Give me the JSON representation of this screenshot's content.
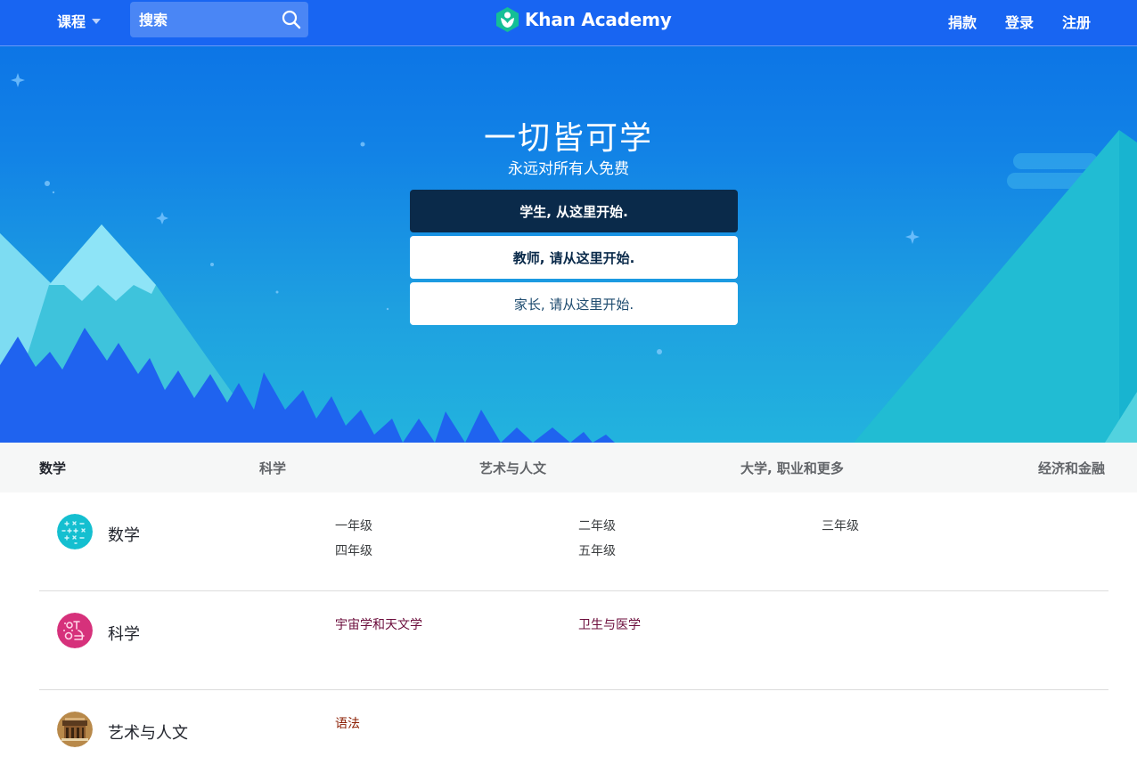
{
  "nav": {
    "courses_label": "课程",
    "search_placeholder": "搜索",
    "logo_text": "Khan Academy",
    "donate_label": "捐款",
    "login_label": "登录",
    "signup_label": "注册"
  },
  "hero": {
    "title": "一切皆可学",
    "subtitle": "永远对所有人免费",
    "cta_student": "学生, 从这里开始.",
    "cta_teacher": "教师, 请从这里开始.",
    "cta_parent": "家长, 请从这里开始."
  },
  "tabs": [
    "数学",
    "科学",
    "艺术与人文",
    "大学, 职业和更多",
    "经济和金融"
  ],
  "subjects": [
    {
      "title": "数学",
      "links": [
        "一年级",
        "二年级",
        "三年级",
        "四年级",
        "五年级"
      ]
    },
    {
      "title": "科学",
      "links": [
        "宇宙学和天文学",
        "卫生与医学"
      ]
    },
    {
      "title": "艺术与人文",
      "links": [
        "语法"
      ]
    }
  ],
  "colors": {
    "brand_blue": "#1865f2",
    "cta_dark": "#0a2a4a",
    "math_badge": "#14bfd0",
    "science_badge": "#d6317b",
    "science_link": "#6b0c3b",
    "arts_link": "#8a1c00"
  }
}
